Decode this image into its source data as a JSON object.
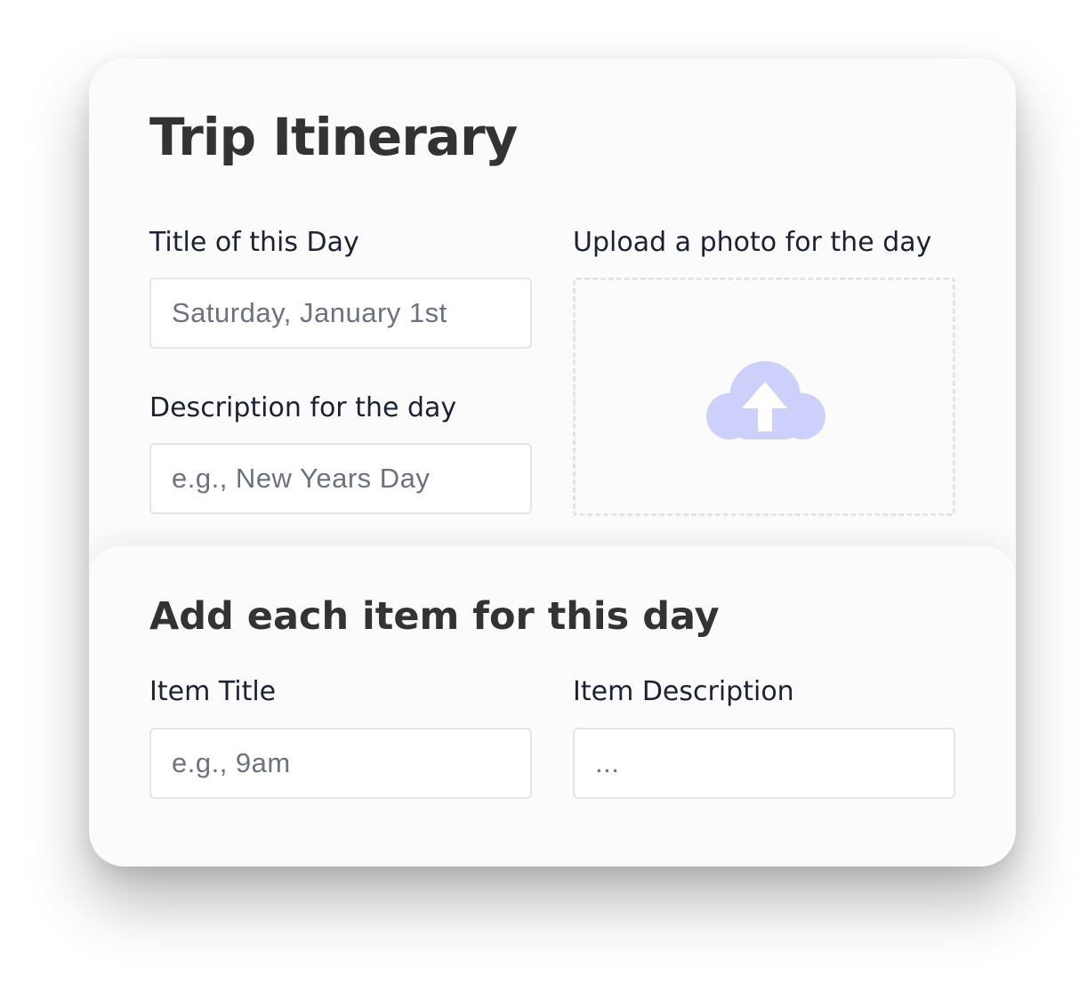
{
  "form": {
    "title": "Trip Itinerary",
    "day_title": {
      "label": "Title of this Day",
      "placeholder": "Saturday, January 1st"
    },
    "day_description": {
      "label": "Description for the day",
      "placeholder": "e.g., New Years Day"
    },
    "photo_upload": {
      "label": "Upload a photo for the day",
      "icon": "cloud-upload-icon"
    }
  },
  "items_section": {
    "title": "Add each item for this day",
    "item_title": {
      "label": "Item Title",
      "placeholder": "e.g., 9am"
    },
    "item_description": {
      "label": "Item Description",
      "placeholder": "..."
    }
  },
  "colors": {
    "heading": "#333336",
    "label": "#1b2233",
    "placeholder": "#6b7280",
    "upload_icon": "#cdd0fa",
    "input_border": "#e3e5ea"
  }
}
